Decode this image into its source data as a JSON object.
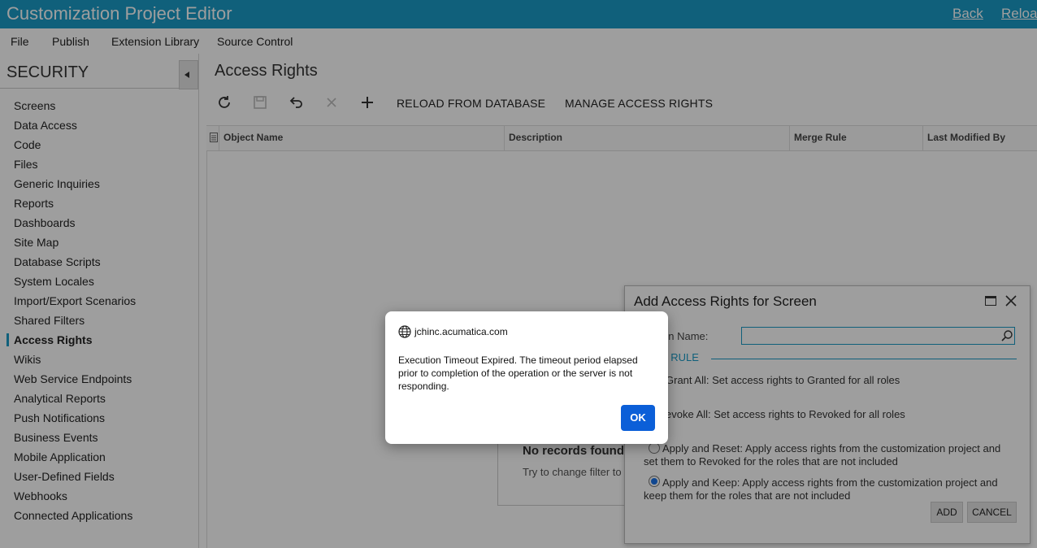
{
  "app": {
    "title": "Customization Project Editor",
    "links": {
      "back": "Back",
      "reload": "Reload"
    }
  },
  "menu": [
    "File",
    "Publish",
    "Extension Library",
    "Source Control"
  ],
  "sidebar": {
    "title": "SECURITY",
    "items": [
      {
        "label": "Screens"
      },
      {
        "label": "Data Access"
      },
      {
        "label": "Code"
      },
      {
        "label": "Files"
      },
      {
        "label": "Generic Inquiries"
      },
      {
        "label": "Reports"
      },
      {
        "label": "Dashboards"
      },
      {
        "label": "Site Map"
      },
      {
        "label": "Database Scripts"
      },
      {
        "label": "System Locales"
      },
      {
        "label": "Import/Export Scenarios"
      },
      {
        "label": "Shared Filters"
      },
      {
        "label": "Access Rights",
        "active": true
      },
      {
        "label": "Wikis"
      },
      {
        "label": "Web Service Endpoints"
      },
      {
        "label": "Analytical Reports"
      },
      {
        "label": "Push Notifications"
      },
      {
        "label": "Business Events"
      },
      {
        "label": "Mobile Application"
      },
      {
        "label": "User-Defined Fields"
      },
      {
        "label": "Webhooks"
      },
      {
        "label": "Connected Applications"
      }
    ]
  },
  "main": {
    "title": "Access Rights",
    "toolbar": {
      "icons": [
        "refresh-icon",
        "save-icon",
        "undo-icon",
        "delete-icon",
        "add-icon"
      ],
      "reload_db": "RELOAD FROM DATABASE",
      "manage": "MANAGE ACCESS RIGHTS"
    },
    "columns": [
      "Object Name",
      "Description",
      "Merge Rule",
      "Last Modified By"
    ],
    "empty": {
      "title": "No records found",
      "subtitle": "Try to change filter to"
    }
  },
  "panel": {
    "title": "Add Access Rights for Screen",
    "screen_name_label": "en Name:",
    "screen_name_value": "",
    "section": "E RULE",
    "options": [
      {
        "line1": "Grant All: Set access rights to Granted for all roles",
        "line2": ""
      },
      {
        "line1": "evoke All: Set access rights to Revoked for all roles",
        "line2": ""
      },
      {
        "line1": "Apply and Reset: Apply access rights from the customization project and",
        "line2": "set them to Revoked for the roles that are not included"
      },
      {
        "line1": "Apply and Keep: Apply access rights from the customization project and",
        "line2": "keep them for the roles that are not included",
        "selected": true
      }
    ],
    "add": "ADD",
    "cancel": "CANCEL"
  },
  "dialog": {
    "origin": "jchinc.acumatica.com",
    "message": "Execution Timeout Expired.  The timeout period elapsed prior to completion of the operation or the server is not responding.",
    "ok": "OK"
  },
  "colors": {
    "accent": "#1a9bc7",
    "ok_button": "#0b5fd8"
  }
}
